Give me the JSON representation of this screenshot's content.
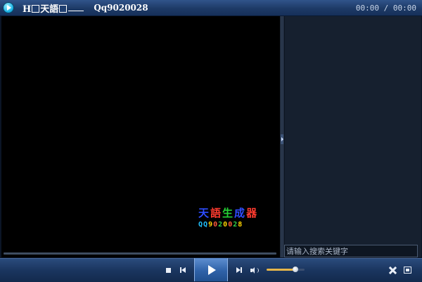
{
  "titlebar": {
    "logo_text": "天語",
    "logo_prefix": "H",
    "title_id": "Qq9020028",
    "time_current": "00:00",
    "time_separator": " / ",
    "time_total": "00:00"
  },
  "watermark": {
    "line1_chars": [
      "天",
      "語",
      "生",
      "成",
      "器"
    ],
    "line1_colors": [
      "#2e4dff",
      "#ff3b2f",
      "#25d235",
      "#2e4dff",
      "#ff3b2f"
    ],
    "line2": "QQ9020028",
    "line2_colors": [
      "#22c3ff",
      "#22c3ff",
      "#ffd400",
      "#ff5a3a",
      "#32d24a",
      "#ffd400",
      "#ff5a3a",
      "#32d24a",
      "#ffd400"
    ]
  },
  "playlist": {
    "search_placeholder": "请输入搜索关键字",
    "search_value": ""
  },
  "controls": {
    "volume_level": 0.75,
    "accent_color": "#e6b64a",
    "icons": [
      "stop-icon",
      "previous-icon",
      "play-icon",
      "next-icon",
      "volume-icon",
      "tools-icon",
      "fullscreen-icon"
    ]
  }
}
